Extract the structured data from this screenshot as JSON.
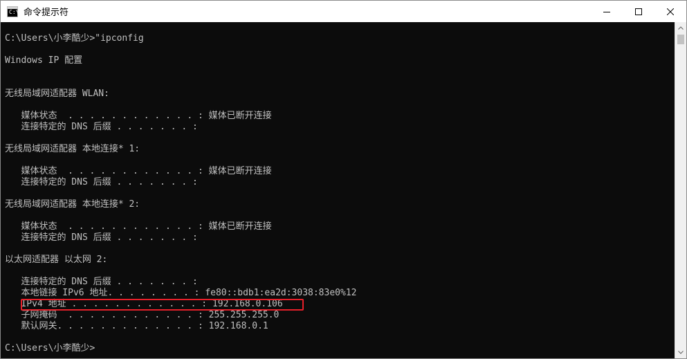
{
  "window": {
    "title": "命令提示符",
    "icon_glyph": "C:\\"
  },
  "icons": {
    "app": "console-app-icon",
    "minimize": "minimize-icon",
    "maximize": "maximize-icon",
    "close": "close-icon",
    "scroll_up": "chevron-up-icon",
    "scroll_down": "chevron-down-icon"
  },
  "console": {
    "lines": [
      "C:\\Users\\小李酷少>\"ipconfig",
      "",
      "Windows IP 配置",
      "",
      "",
      "无线局域网适配器 WLAN:",
      "",
      "   媒体状态  . . . . . . . . . . . . : 媒体已断开连接",
      "   连接特定的 DNS 后缀 . . . . . . . :",
      "",
      "无线局域网适配器 本地连接* 1:",
      "",
      "   媒体状态  . . . . . . . . . . . . : 媒体已断开连接",
      "   连接特定的 DNS 后缀 . . . . . . . :",
      "",
      "无线局域网适配器 本地连接* 2:",
      "",
      "   媒体状态  . . . . . . . . . . . . : 媒体已断开连接",
      "   连接特定的 DNS 后缀 . . . . . . . :",
      "",
      "以太网适配器 以太网 2:",
      "",
      "   连接特定的 DNS 后缀 . . . . . . . :",
      "   本地链接 IPv6 地址. . . . . . . . : fe80::bdb1:ea2d:3038:83e0%12",
      "   IPv4 地址 . . . . . . . . . . . . : 192.168.0.106",
      "   子网掩码  . . . . . . . . . . . . : 255.255.255.0",
      "   默认网关. . . . . . . . . . . . . : 192.168.0.1",
      "",
      "C:\\Users\\小李酷少>"
    ]
  },
  "colors": {
    "console_background": "#0c0c0c",
    "console_text": "#c0c0c0",
    "highlight_border": "#e8202a",
    "titlebar_background": "#ffffff"
  }
}
